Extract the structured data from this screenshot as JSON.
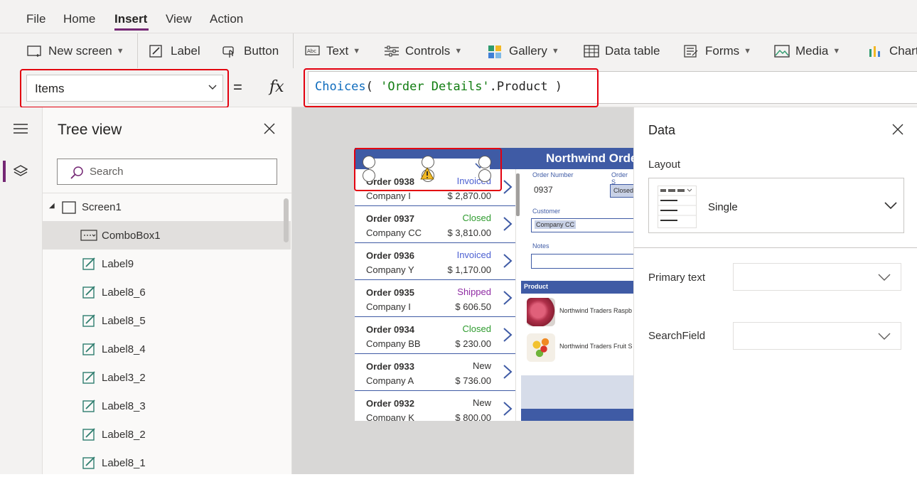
{
  "menu": {
    "file": "File",
    "home": "Home",
    "insert": "Insert",
    "view": "View",
    "action": "Action"
  },
  "ribbon": {
    "new_screen": "New screen",
    "label": "Label",
    "button": "Button",
    "text": "Text",
    "controls": "Controls",
    "gallery": "Gallery",
    "data_table": "Data table",
    "forms": "Forms",
    "media": "Media",
    "charts": "Charts"
  },
  "formula_bar": {
    "property": "Items",
    "equals": "=",
    "fx": "fx",
    "formula": {
      "fn": "Choices",
      "open": "( ",
      "str": "'Order Details'",
      "rest": ".Product )"
    }
  },
  "tree_view": {
    "title": "Tree view",
    "search_placeholder": "Search",
    "items": [
      {
        "label": "Screen1"
      },
      {
        "label": "ComboBox1"
      },
      {
        "label": "Label9"
      },
      {
        "label": "Label8_6"
      },
      {
        "label": "Label8_5"
      },
      {
        "label": "Label8_4"
      },
      {
        "label": "Label3_2"
      },
      {
        "label": "Label8_3"
      },
      {
        "label": "Label8_2"
      },
      {
        "label": "Label8_1"
      }
    ]
  },
  "app": {
    "title": "Northwind Orders",
    "orders": [
      {
        "number": "Order 0938",
        "company": "Company I",
        "status": "Invoiced",
        "amount": "$ 2,870.00",
        "status_color": "#4b5fd1"
      },
      {
        "number": "Order 0937",
        "company": "Company CC",
        "status": "Closed",
        "amount": "$ 3,810.00",
        "status_color": "#2e9b2e"
      },
      {
        "number": "Order 0936",
        "company": "Company Y",
        "status": "Invoiced",
        "amount": "$ 1,170.00",
        "status_color": "#4b5fd1"
      },
      {
        "number": "Order 0935",
        "company": "Company I",
        "status": "Shipped",
        "amount": "$ 606.50",
        "status_color": "#8f2ba3"
      },
      {
        "number": "Order 0934",
        "company": "Company BB",
        "status": "Closed",
        "amount": "$ 230.00",
        "status_color": "#2e9b2e"
      },
      {
        "number": "Order 0933",
        "company": "Company A",
        "status": "New",
        "amount": "$ 736.00",
        "status_color": "#323130"
      },
      {
        "number": "Order 0932",
        "company": "Company K",
        "status": "New",
        "amount": "$ 800.00",
        "status_color": "#323130"
      }
    ],
    "detail": {
      "order_number_label": "Order Number",
      "order_number": "0937",
      "order_status_label": "Order S",
      "order_status": "Closed",
      "customer_label": "Customer",
      "customer": "Company CC",
      "notes_label": "Notes",
      "product_header": "Product",
      "products": [
        {
          "name": "Northwind Traders Raspb"
        },
        {
          "name": "Northwind Traders Fruit S"
        }
      ]
    }
  },
  "data_pane": {
    "title": "Data",
    "layout_label": "Layout",
    "layout_value": "Single",
    "primary_text_label": "Primary text",
    "search_field_label": "SearchField"
  },
  "colors": {
    "accent": "#742774",
    "app_blue": "#3f5ba5",
    "highlight": "#e3000f"
  }
}
